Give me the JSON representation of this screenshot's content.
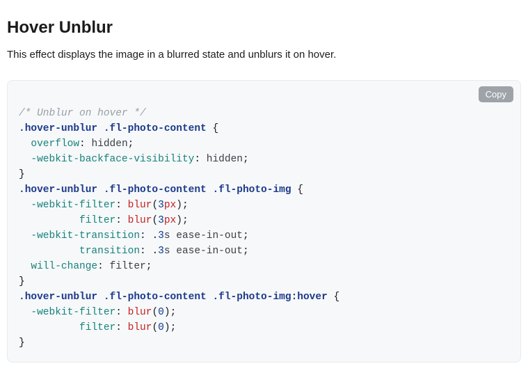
{
  "heading": "Hover Unblur",
  "description": "This effect displays the image in a blurred state and unblurs it on hover.",
  "copy_label": "Copy",
  "code": {
    "comment": "/* Unblur on hover */",
    "rules": [
      {
        "selector": ".hover-unblur .fl-photo-content",
        "decls": [
          {
            "indent": 2,
            "prop": "overflow",
            "value_plain": "hidden"
          },
          {
            "indent": 2,
            "prop": "-webkit-backface-visibility",
            "value_plain": "hidden"
          }
        ]
      },
      {
        "selector": ".hover-unblur .fl-photo-content .fl-photo-img",
        "decls": [
          {
            "indent": 2,
            "prop": "-webkit-filter",
            "func": "blur",
            "num": "3",
            "unit": "px"
          },
          {
            "indent": 10,
            "prop": "filter",
            "func": "blur",
            "num": "3",
            "unit": "px"
          },
          {
            "indent": 2,
            "prop": "-webkit-transition",
            "leading_dot_num": "3",
            "trailing": "s ease-in-out"
          },
          {
            "indent": 10,
            "prop": "transition",
            "leading_dot_num": "3",
            "trailing": "s ease-in-out"
          },
          {
            "indent": 2,
            "prop": "will-change",
            "value_plain": "filter"
          }
        ]
      },
      {
        "selector": ".hover-unblur .fl-photo-content .fl-photo-img",
        "pseudo": ":hover",
        "decls": [
          {
            "indent": 2,
            "prop": "-webkit-filter",
            "func": "blur",
            "num": "0"
          },
          {
            "indent": 10,
            "prop": "filter",
            "func": "blur",
            "num": "0"
          }
        ]
      }
    ]
  }
}
